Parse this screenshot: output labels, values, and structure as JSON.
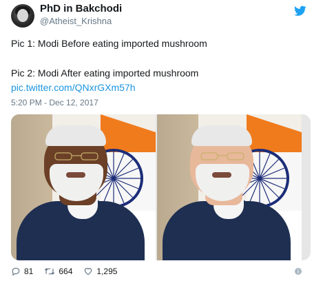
{
  "tweet": {
    "display_name": "PhD in Bakchodi",
    "handle": "@Atheist_Krishna",
    "line1": "Pic 1: Modi Before eating imported mushroom",
    "line2": "Pic 2: Modi After eating imported mushroom",
    "link": "pic.twitter.com/QNxrGXm57h",
    "timestamp": "5:20 PM - Dec 12, 2017"
  },
  "actions": {
    "replies": "81",
    "retweets": "664",
    "likes": "1,295"
  },
  "icons": {
    "logo": "twitter-bird-icon",
    "reply": "reply-icon",
    "retweet": "retweet-icon",
    "like": "heart-icon",
    "info": "info-icon"
  },
  "colors": {
    "brand": "#1da1f2",
    "link": "#1b95e0",
    "muted": "#657786"
  }
}
